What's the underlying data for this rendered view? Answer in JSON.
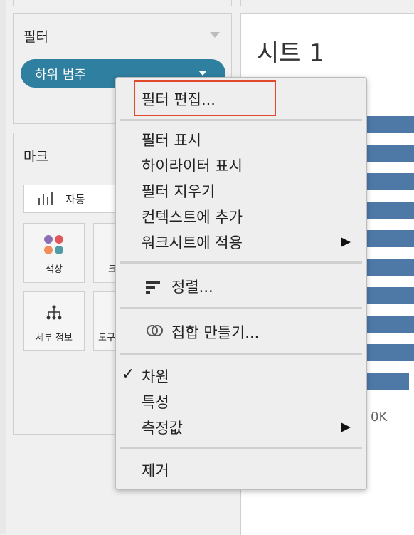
{
  "filters_card": {
    "title": "필터",
    "pill_label": "하위 범주"
  },
  "marks_card": {
    "title": "마크",
    "mark_type": "자동",
    "tiles": [
      "색상",
      "크기",
      "세부 정보",
      "도구 설명"
    ],
    "tile_partial_labels": [
      "크",
      "도구"
    ]
  },
  "sheet": {
    "title": "시트 1",
    "axis_label": "0K"
  },
  "chart_data": {
    "type": "bar",
    "orientation": "horizontal",
    "values_note_hidden": true,
    "series_color": "#4e79a7"
  },
  "context_menu": {
    "edit_filter": "필터 편집...",
    "show_filter": "필터 표시",
    "show_highlighter": "하이라이터 표시",
    "clear_filter": "필터 지우기",
    "add_to_context": "컨텍스트에 추가",
    "apply_to_worksheets": "워크시트에 적용",
    "sort": "정렬...",
    "create_set": "집합 만들기...",
    "dimension": "차원",
    "attribute": "특성",
    "measure": "측정값",
    "remove": "제거",
    "checkmark": "✓"
  },
  "colors": {
    "pill": "#2f7fa0",
    "bar": "#4e79a7",
    "highlight": "#e04a2a"
  }
}
